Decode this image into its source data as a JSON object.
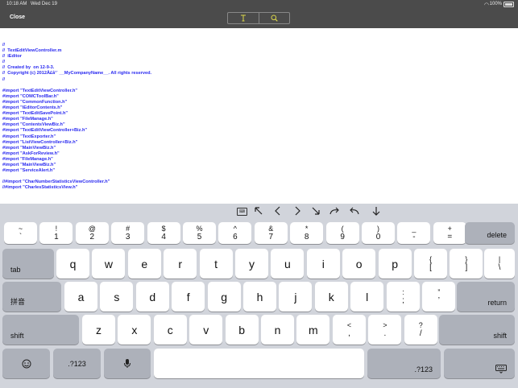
{
  "status_bar": {
    "time": "10:18 AM",
    "date": "Wed Dec 19",
    "battery": "100%"
  },
  "nav": {
    "close_label": "Close",
    "icons": [
      "text-cursor-icon",
      "search-icon"
    ]
  },
  "editor": {
    "lines": [
      "//",
      "//  TextEditViewController.m",
      "//  iEditor",
      "//",
      "//  Created by  on 12-9-3.",
      "//  Copyright (c) 2012Å£å¹´ __MyCompanyName__. All rights reserved.",
      "//",
      "",
      "#import \"TextEditViewController.h\"",
      "#import \"COMCToolBar.h\"",
      "#import \"CommonFunction.h\"",
      "#import \"iEditorContents.h\"",
      "#import \"TextEditSavePoint.h\"",
      "#import \"FileManage.h\"",
      "#import \"ContentsViewBiz.h\"",
      "#import \"TextEditViewController+Biz.h\"",
      "#import \"TextExporter.h\"",
      "#import \"ListViewController+Biz.h\"",
      "#import \"MainViewBiz.h\"",
      "#import \"AskForReview.h\"",
      "#import \"FileManage.h\"",
      "#import \"MainViewBiz.h\"",
      "#import \"ServiceAlert.h\"",
      "",
      "//#import \"CharNumberStatisticsViewController.h\"",
      "//#import \"CharlesStatisticsView.h\""
    ]
  },
  "shortcuts": [
    "keyboard-hide-icon",
    "arrow-up-left-icon",
    "arrow-left-icon",
    "arrow-right-icon",
    "arrow-down-right-icon",
    "redo-icon",
    "undo-icon",
    "arrow-down-icon"
  ],
  "keyboard": {
    "row1": [
      {
        "top": "~",
        "bot": "`"
      },
      {
        "top": "!",
        "bot": "1"
      },
      {
        "top": "@",
        "bot": "2"
      },
      {
        "top": "#",
        "bot": "3"
      },
      {
        "top": "$",
        "bot": "4"
      },
      {
        "top": "%",
        "bot": "5"
      },
      {
        "top": "^",
        "bot": "6"
      },
      {
        "top": "&",
        "bot": "7"
      },
      {
        "top": "*",
        "bot": "8"
      },
      {
        "top": "(",
        "bot": "9"
      },
      {
        "top": ")",
        "bot": "0"
      },
      {
        "top": "_",
        "bot": "-"
      },
      {
        "top": "+",
        "bot": "="
      }
    ],
    "delete": "delete",
    "tab": "tab",
    "row2": [
      "q",
      "w",
      "e",
      "r",
      "t",
      "y",
      "u",
      "i",
      "o",
      "p"
    ],
    "row2_sym": [
      {
        "top": "{",
        "bot": "["
      },
      {
        "top": "}",
        "bot": "]"
      },
      {
        "top": "|",
        "bot": "\\"
      }
    ],
    "lang": "拼音",
    "row3": [
      "a",
      "s",
      "d",
      "f",
      "g",
      "h",
      "j",
      "k",
      "l"
    ],
    "row3_sym": [
      {
        "top": ":",
        "bot": ";"
      },
      {
        "top": "”",
        "bot": "’"
      }
    ],
    "return": "return",
    "shift": "shift",
    "row4": [
      "z",
      "x",
      "c",
      "v",
      "b",
      "n",
      "m"
    ],
    "row4_sym": [
      {
        "top": "<",
        "bot": ","
      },
      {
        "top": ">",
        "bot": "."
      },
      {
        "top": "?",
        "bot": "/"
      }
    ],
    "numbers": ".?123"
  }
}
